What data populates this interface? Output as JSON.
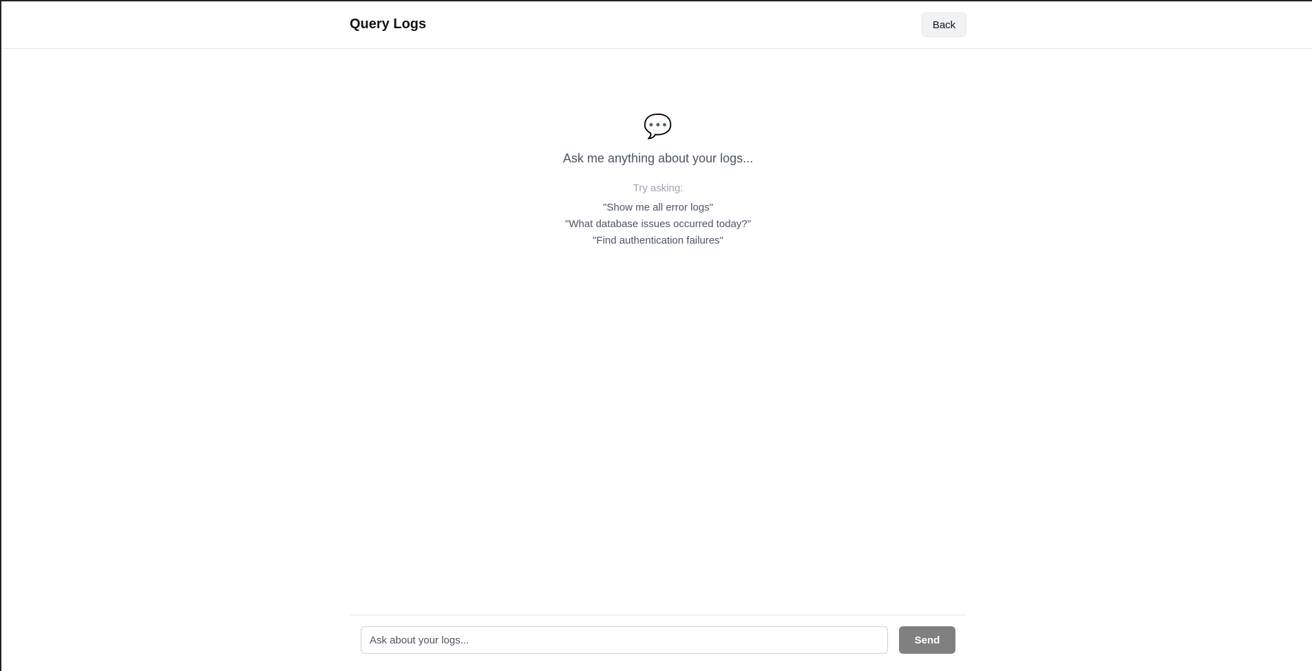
{
  "header": {
    "title": "Query Logs",
    "back_label": "Back"
  },
  "empty_state": {
    "icon": "speech-bubble-icon",
    "icon_glyph": "💬",
    "message": "Ask me anything about your logs...",
    "try_label": "Try asking:",
    "suggestions": [
      "\"Show me all error logs\"",
      "\"What database issues occurred today?\"",
      "\"Find authentication failures\""
    ]
  },
  "composer": {
    "placeholder": "Ask about your logs...",
    "value": "",
    "send_label": "Send"
  }
}
